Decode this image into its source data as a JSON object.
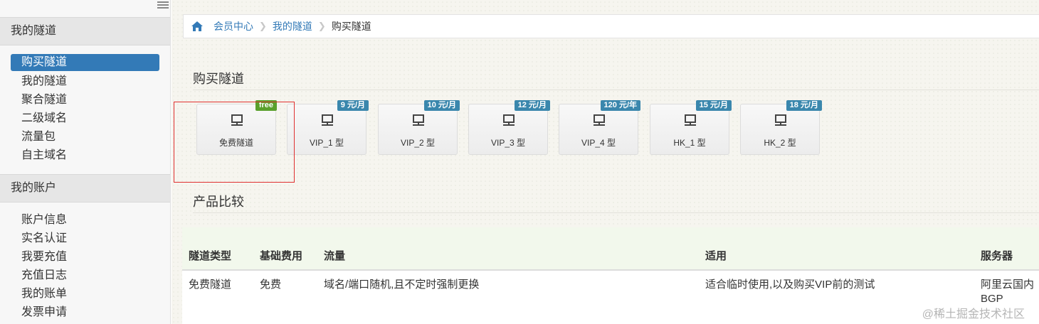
{
  "sidebar": {
    "sections": [
      {
        "title": "我的隧道",
        "items": [
          {
            "label": "购买隧道",
            "active": true
          },
          {
            "label": "我的隧道"
          },
          {
            "label": "聚合隧道"
          },
          {
            "label": "二级域名"
          },
          {
            "label": "流量包"
          },
          {
            "label": "自主域名"
          }
        ]
      },
      {
        "title": "我的账户",
        "items": [
          {
            "label": "账户信息"
          },
          {
            "label": "实名认证"
          },
          {
            "label": "我要充值"
          },
          {
            "label": "充值日志"
          },
          {
            "label": "我的账单"
          },
          {
            "label": "发票申请"
          }
        ]
      }
    ]
  },
  "breadcrumb": {
    "home_icon": "home-icon",
    "items": [
      "会员中心",
      "我的隧道",
      "购买隧道"
    ]
  },
  "purchase": {
    "title": "购买隧道",
    "plans": [
      {
        "name": "免费隧道",
        "badge": "free"
      },
      {
        "name": "VIP_1 型",
        "badge": "9 元/月"
      },
      {
        "name": "VIP_2 型",
        "badge": "10 元/月"
      },
      {
        "name": "VIP_3 型",
        "badge": "12 元/月"
      },
      {
        "name": "VIP_4 型",
        "badge": "120 元/年"
      },
      {
        "name": "HK_1 型",
        "badge": "15 元/月"
      },
      {
        "name": "HK_2 型",
        "badge": "18 元/月"
      }
    ]
  },
  "compare": {
    "title": "产品比较",
    "headers": [
      "隧道类型",
      "基础费用",
      "流量",
      "适用",
      "服务器"
    ],
    "rows": [
      [
        "免费隧道",
        "免费",
        "域名/端口随机,且不定时强制更换",
        "适合临时使用,以及购买VIP前的测试",
        "阿里云国内 BGP"
      ]
    ]
  },
  "watermark": "@稀土掘金技术社区",
  "colors": {
    "accent": "#337ab7",
    "badge": "#3a87ad",
    "free_badge": "#5aa02c",
    "highlight": "#e03030"
  }
}
